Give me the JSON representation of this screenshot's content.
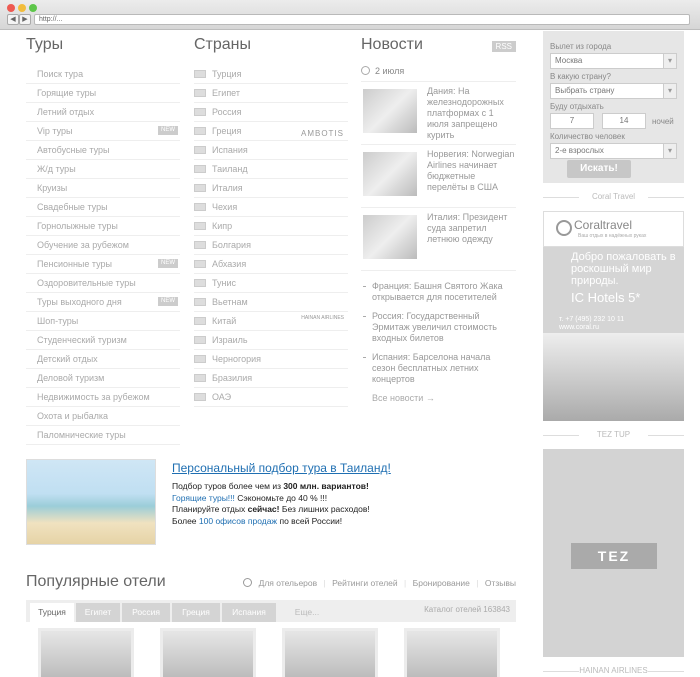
{
  "browser": {
    "url": "http://..."
  },
  "tours": {
    "title": "Туры",
    "items": [
      {
        "label": "Поиск тура",
        "badge": ""
      },
      {
        "label": "Горящие туры",
        "badge": ""
      },
      {
        "label": "Летний отдых",
        "badge": ""
      },
      {
        "label": "Vip туры",
        "badge": "NEW"
      },
      {
        "label": "Автобусные туры",
        "badge": ""
      },
      {
        "label": "Ж/д туры",
        "badge": ""
      },
      {
        "label": "Круизы",
        "badge": ""
      },
      {
        "label": "Свадебные туры",
        "badge": ""
      },
      {
        "label": "Горнолыжные туры",
        "badge": ""
      },
      {
        "label": "Обучение за рубежом",
        "badge": ""
      },
      {
        "label": "Пенсионные туры",
        "badge": "NEW"
      },
      {
        "label": "Оздоровительные туры",
        "badge": ""
      },
      {
        "label": "Туры выходного дня",
        "badge": "NEW"
      },
      {
        "label": "Шоп-туры",
        "badge": ""
      },
      {
        "label": "Студенческий туризм",
        "badge": ""
      },
      {
        "label": "Детский отдых",
        "badge": ""
      },
      {
        "label": "Деловой туризм",
        "badge": ""
      },
      {
        "label": "Недвижимость за рубежом",
        "badge": ""
      },
      {
        "label": "Охота и рыбалка",
        "badge": ""
      },
      {
        "label": "Паломнические туры",
        "badge": ""
      }
    ]
  },
  "countries": {
    "title": "Страны",
    "items": [
      {
        "label": "Турция",
        "sponsor": ""
      },
      {
        "label": "Египет",
        "sponsor": ""
      },
      {
        "label": "Россия",
        "sponsor": ""
      },
      {
        "label": "Греция",
        "sponsor": "AMBOTIS"
      },
      {
        "label": "Испания",
        "sponsor": ""
      },
      {
        "label": "Таиланд",
        "sponsor": ""
      },
      {
        "label": "Италия",
        "sponsor": ""
      },
      {
        "label": "Чехия",
        "sponsor": ""
      },
      {
        "label": "Кипр",
        "sponsor": ""
      },
      {
        "label": "Болгария",
        "sponsor": ""
      },
      {
        "label": "Абхазия",
        "sponsor": ""
      },
      {
        "label": "Тунис",
        "sponsor": ""
      },
      {
        "label": "Вьетнам",
        "sponsor": ""
      },
      {
        "label": "Китай",
        "sponsor": "HAINAN AIRLINES"
      },
      {
        "label": "Израиль",
        "sponsor": ""
      },
      {
        "label": "Черногория",
        "sponsor": ""
      },
      {
        "label": "Бразилия",
        "sponsor": ""
      },
      {
        "label": "ОАЭ",
        "sponsor": ""
      }
    ]
  },
  "news": {
    "title": "Новости",
    "rss": "RSS",
    "date": "2 июля",
    "featured": [
      "Дания: На железнодорожных платформах с 1 июля запрещено курить",
      "Норвегия: Norwegian Airlines начинает бюджетные перелёты в США",
      "Италия: Президент суда запретил летнюю одежду"
    ],
    "plain": [
      "Франция: Башня Святого Жака открывается для посетителей",
      "Россия: Государственный Эрмитаж увеличил стоимость входных билетов",
      "Испания: Барселона начала сезон бесплатных летних концертов"
    ],
    "all": "Все новости →"
  },
  "search": {
    "from_label": "Вылет из города",
    "from_value": "Москва",
    "to_label": "В какую страну?",
    "to_value": "Выбрать страну",
    "rest_label": "Буду отдыхать",
    "nights_from": "7",
    "nights_to": "14",
    "nights_unit": "ночей",
    "people_label": "Количество человек",
    "people_value": "2-е взрослых",
    "button": "Искать!"
  },
  "ads": {
    "coral_label": "Coral Travel",
    "coral_logo": "Coraltravel",
    "coral_sub": "Ваш отдых в надёжных руках",
    "coral_head": "Добро пожаловать в роскошный мир природы.",
    "coral_hotel": "IC Hotels 5*",
    "coral_phone": "т. +7 (495) 232 10 11",
    "coral_site": "www.coral.ru",
    "tez_label": "TEZ TUP",
    "tez_logo": "TEZ",
    "hainan_label": "HAINAN AIRLINES"
  },
  "promo": {
    "title": "Персональный подбор тура в Таиланд!",
    "line1_a": "Подбор туров более чем из ",
    "line1_b": "300 млн. вариантов!",
    "line2_a": "Горящие туры!!!",
    "line2_b": " Сэкономьте до 40 % !!!",
    "line3_a": "Планируйте отдых ",
    "line3_b": "сейчас!",
    "line3_c": " Без лишних расходов!",
    "line4_a": "Более ",
    "line4_b": "100 офисов продаж",
    "line4_c": " по всей России!"
  },
  "hotels": {
    "title": "Популярные отели",
    "links": [
      "Для отельеров",
      "Рейтинги отелей",
      "Бронирование",
      "Отзывы"
    ],
    "tabs": [
      "Турция",
      "Египет",
      "Россия",
      "Греция",
      "Испания"
    ],
    "more": "Еще...",
    "catalog_label": "Каталог отелей",
    "catalog_count": "163843"
  }
}
